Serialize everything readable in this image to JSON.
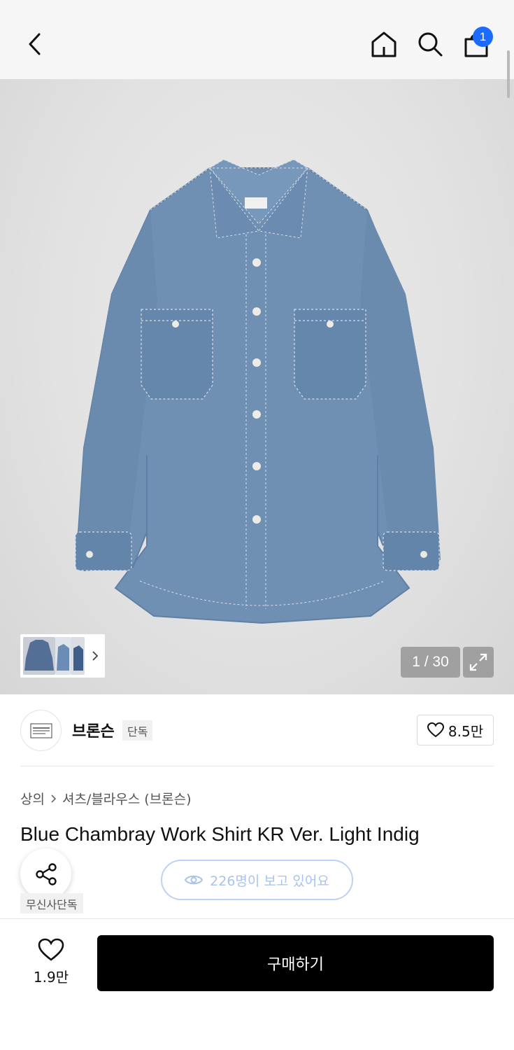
{
  "header": {
    "cart_count": "1",
    "icons": [
      "chevron-left-icon",
      "home-icon",
      "search-icon",
      "shopping-bag-icon"
    ]
  },
  "gallery": {
    "counter": "1 / 30",
    "product_colors": {
      "denim": "#6f8fb3",
      "denim_dark": "#5d7ea4",
      "stitch": "#d9dfe6"
    }
  },
  "brand": {
    "name": "브론슨",
    "tag": "단독",
    "likes": "8.5만"
  },
  "product": {
    "breadcrumb": [
      "상의",
      "셔츠/블라우스 (브론슨)"
    ],
    "title": "Blue Chambray Work Shirt KR Ver. Light Indig",
    "viewers": "226명이 보고 있어요",
    "tag": "무신사단독"
  },
  "bottom_bar": {
    "like_count": "1.9만",
    "buy_label": "구매하기"
  },
  "colors": {
    "accent": "#1c6bff",
    "buy_button": "#000000"
  }
}
